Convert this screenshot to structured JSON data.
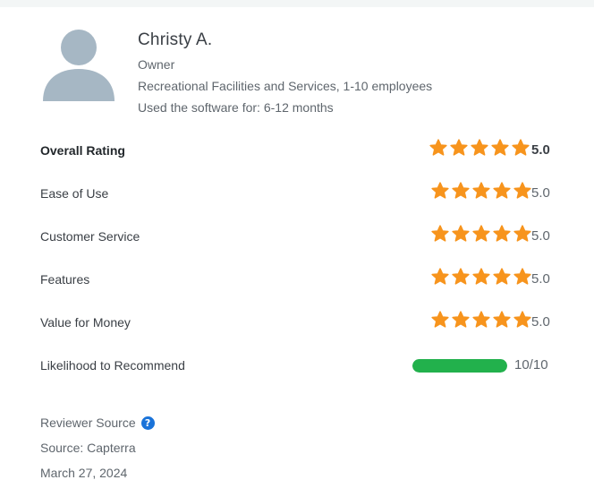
{
  "reviewer": {
    "name": "Christy A.",
    "role": "Owner",
    "company": "Recreational Facilities and Services, 1-10 employees",
    "usage": "Used the software for: 6-12 months",
    "avatar_icon": "user-silhouette-icon"
  },
  "ratings": [
    {
      "label": "Overall Rating",
      "stars": 5,
      "score": "5.0"
    },
    {
      "label": "Ease of Use",
      "stars": 5,
      "score": "5.0"
    },
    {
      "label": "Customer Service",
      "stars": 5,
      "score": "5.0"
    },
    {
      "label": "Features",
      "stars": 5,
      "score": "5.0"
    },
    {
      "label": "Value for Money",
      "stars": 5,
      "score": "5.0"
    }
  ],
  "recommend": {
    "label": "Likelihood to Recommend",
    "value": 10,
    "max": 10,
    "text": "10/10"
  },
  "footer": {
    "reviewer_source_label": "Reviewer Source",
    "help_icon": "question-mark-icon",
    "help_glyph": "?",
    "source": "Source: Capterra",
    "date": "March 27, 2024"
  },
  "colors": {
    "star": "#f7941d",
    "progress": "#22b14c",
    "avatar": "#a6b7c4",
    "help": "#1a73d9"
  }
}
